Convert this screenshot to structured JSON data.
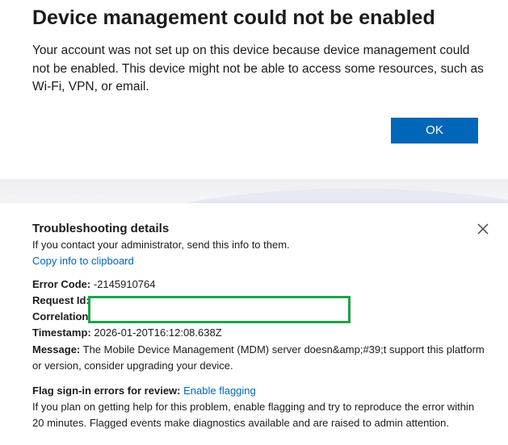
{
  "dialog": {
    "title": "Device management could not be enabled",
    "body": "Your account was not set up on this device because device management could not be enabled. This device might not be able to access some resources, such as Wi-Fi, VPN, or email.",
    "ok_label": "OK"
  },
  "troubleshooting": {
    "title": "Troubleshooting details",
    "subtitle": "If you contact your administrator, send this info to them.",
    "copy_link": "Copy info to clipboard",
    "error_code_label": "Error Code:",
    "error_code_value": "-2145910764",
    "request_id_label": "Request Id:",
    "correlation_label": "Correlation",
    "timestamp_label": "Timestamp:",
    "timestamp_value": "2026-01-20T16:12:08.638Z",
    "message_label": "Message:",
    "message_value": "The Mobile Device Management (MDM) server doesn&amp;#39;t support this platform or version, consider upgrading your device.",
    "flag_label": "Flag sign-in errors for review:",
    "flag_link": "Enable flagging",
    "flag_description": "If you plan on getting help for this problem, enable flagging and try to reproduce the error within 20 minutes. Flagged events make diagnostics available and are raised to admin attention."
  },
  "colors": {
    "accent": "#0067b8",
    "redaction_border": "#1fa34a"
  }
}
